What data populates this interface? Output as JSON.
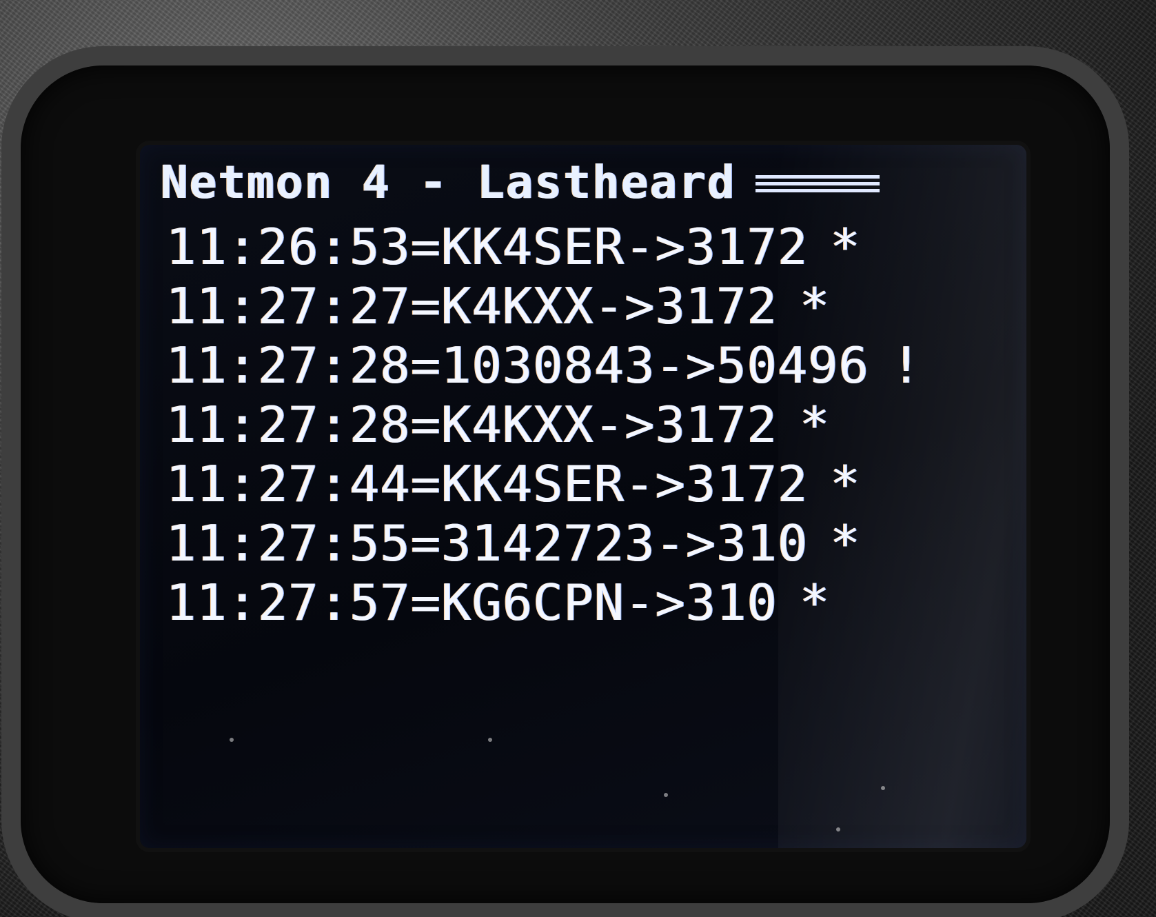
{
  "screen": {
    "title": "Netmon 4 - Lastheard",
    "entries": [
      {
        "text": "11:26:53=KK4SER->3172",
        "marker": "*"
      },
      {
        "text": "11:27:27=K4KXX->3172",
        "marker": "*"
      },
      {
        "text": "11:27:28=1030843->50496",
        "marker": "!"
      },
      {
        "text": "11:27:28=K4KXX->3172",
        "marker": "*"
      },
      {
        "text": "11:27:44=KK4SER->3172",
        "marker": "*"
      },
      {
        "text": "11:27:55=3142723->310",
        "marker": "*"
      },
      {
        "text": "11:27:57=KG6CPN->310",
        "marker": "*"
      }
    ]
  },
  "colors": {
    "screen_background": "#05070e",
    "text": "#f4f7ff",
    "housing": "#3c3c3c"
  }
}
